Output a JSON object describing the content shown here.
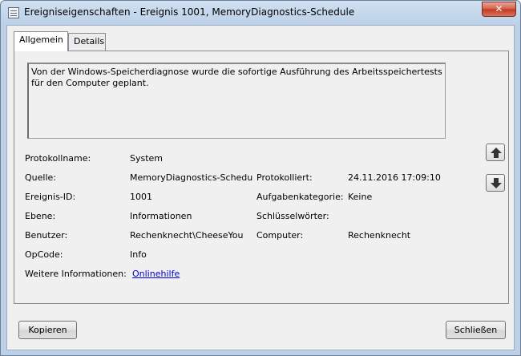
{
  "window": {
    "title": "Ereigniseigenschaften - Ereignis 1001, MemoryDiagnostics-Schedule",
    "close_label": "✕"
  },
  "tabs": [
    {
      "label": "Allgemein",
      "active": true
    },
    {
      "label": "Details",
      "active": false
    }
  ],
  "description": "Von der Windows-Speicherdiagnose wurde die sofortige Ausführung des Arbeitsspeichertests für den Computer geplant.",
  "fields": {
    "protokollname": {
      "label": "Protokollname:",
      "value": "System"
    },
    "quelle": {
      "label": "Quelle:",
      "value": "MemoryDiagnostics-Schedu"
    },
    "protokolliert": {
      "label": "Protokolliert:",
      "value": "24.11.2016 17:09:10"
    },
    "ereignis_id": {
      "label": "Ereignis-ID:",
      "value": "1001"
    },
    "aufgabenkategorie": {
      "label": "Aufgabenkategorie:",
      "value": "Keine"
    },
    "ebene": {
      "label": "Ebene:",
      "value": "Informationen"
    },
    "schluesselwoerter": {
      "label": "Schlüsselwörter:",
      "value": ""
    },
    "benutzer": {
      "label": "Benutzer:",
      "value": "Rechenknecht\\CheeseYou"
    },
    "computer": {
      "label": "Computer:",
      "value": "Rechenknecht"
    },
    "opcode": {
      "label": "OpCode:",
      "value": "Info"
    },
    "weitere": {
      "label": "Weitere Informationen:",
      "link": "Onlinehilfe"
    }
  },
  "buttons": {
    "copy": "Kopieren",
    "close": "Schließen"
  },
  "icons": {
    "up": "arrow-up-icon",
    "down": "arrow-down-icon"
  }
}
